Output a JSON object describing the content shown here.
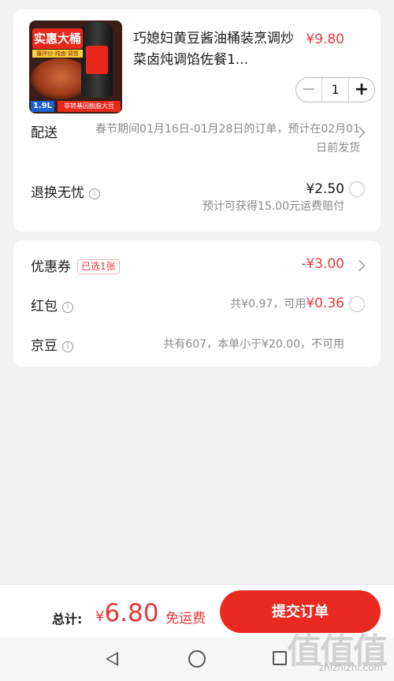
{
  "product": {
    "image_banner": "实惠大桶",
    "image_sub": "蘸拌炒·炖卤·调馅",
    "image_size": "1.9L",
    "image_tag": "非转基因脱脂大豆",
    "title": "巧媳妇黄豆酱油桶装烹调炒菜卤炖调馅佐餐1...",
    "price": "¥9.80",
    "quantity": "1",
    "minus_label": "−",
    "plus_label": "+"
  },
  "delivery": {
    "label": "配送",
    "text": "春节期间01月16日-01月28日的订单，预计在02月01日前发货"
  },
  "return": {
    "label": "退换无忧",
    "price": "¥2.50",
    "note": "预计可获得15.00元运费赔付"
  },
  "coupon": {
    "label": "优惠券",
    "badge": "已选1张",
    "value": "-¥3.00"
  },
  "redpacket": {
    "label": "红包",
    "prefix": "共¥0.97，可用",
    "available": "¥0.36"
  },
  "jingdou": {
    "label": "京豆",
    "text": "共有607，本单小于¥20.00，不可用"
  },
  "footer": {
    "total_label": "总计:",
    "currency": "¥",
    "total_amount": "6.80",
    "free_shipping": "免运费",
    "submit_label": "提交订单"
  },
  "watermark": {
    "logo": "值值值",
    "url": "zhizhizhi.com"
  },
  "colors": {
    "accent": "#e4393c",
    "submit": "#ea2a20",
    "background": "#f2f2f2"
  }
}
